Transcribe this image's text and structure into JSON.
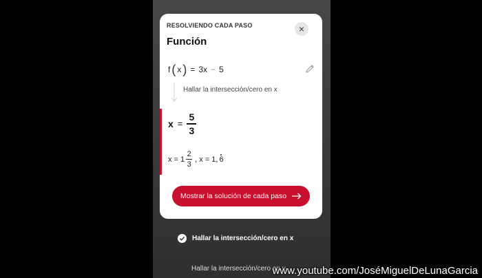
{
  "card": {
    "kicker": "RESOLVIENDO CADA PASO",
    "title": "Función",
    "function": {
      "name": "f",
      "var": "x",
      "eq": "=",
      "coef": "3x",
      "minus": "−",
      "const": "5"
    },
    "step_label": "Hallar la intersección/cero en x",
    "answer": {
      "var": "x",
      "eq": "=",
      "num": "5",
      "den": "3"
    },
    "alt": {
      "prefix": "x = 1",
      "num": "2",
      "den": "3",
      "sep": ", x = 1,",
      "tail": "6"
    },
    "cta_label": "Mostrar la solución de cada paso",
    "close_icon": "×"
  },
  "background": {
    "completed_step": "Hallar la intersección/cero en x",
    "next_step": "Hallar la intersección/cero en y"
  },
  "watermark": "www.youtube.com/JoséMiguelDeLunaGarcia",
  "colors": {
    "accent": "#c8102e"
  }
}
